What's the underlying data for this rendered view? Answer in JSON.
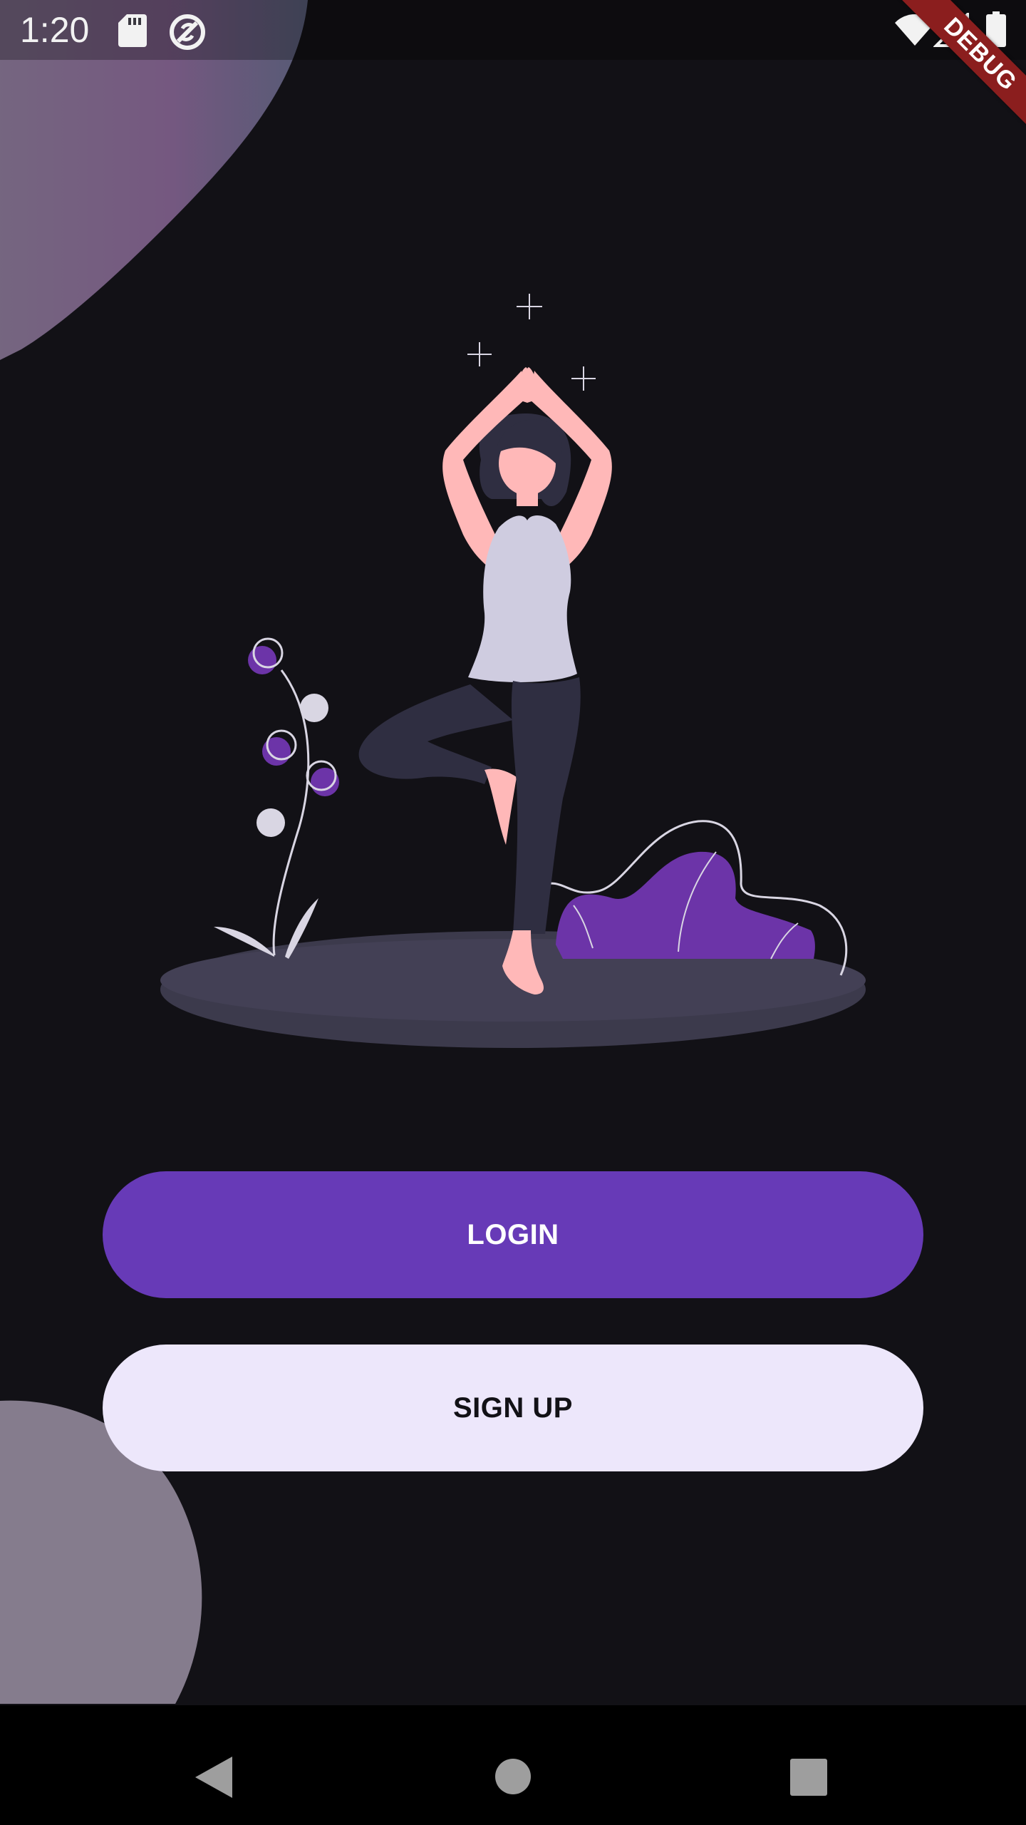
{
  "status_bar": {
    "time": "1:20",
    "icons": [
      "sd-card-icon",
      "sync-icon",
      "wifi-icon",
      "signal-icon",
      "battery-icon"
    ]
  },
  "debug_banner": {
    "label": "DEBUG"
  },
  "illustration": {
    "subject": "yoga-woman-icon"
  },
  "buttons": {
    "login_label": "LOGIN",
    "signup_label": "SIGN UP"
  },
  "nav_bar": {
    "icons": [
      "back-icon",
      "home-icon",
      "recents-icon"
    ]
  },
  "colors": {
    "background": "#121116",
    "primary": "#673ab7",
    "secondary_button": "#ede7fb",
    "blob": "#8e8394",
    "debug_banner": "#8b1e1e"
  }
}
